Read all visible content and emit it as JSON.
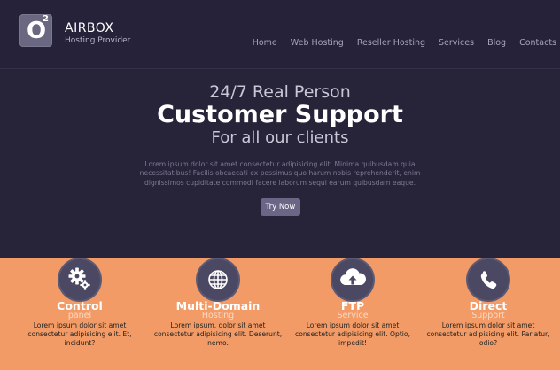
{
  "brand": {
    "logo_letter": "O",
    "logo_sup": "2",
    "name": "AIRBOX",
    "tagline": "Hosting Provider"
  },
  "nav": {
    "items": [
      "Home",
      "Web Hosting",
      "Reseller Hosting",
      "Services",
      "Blog",
      "Contacts"
    ]
  },
  "hero": {
    "line1": "24/7 Real Person",
    "line2": "Customer Support",
    "line3": "For all our clients",
    "paragraph": "Lorem ipsum dolor sit amet consectetur adipisicing elit. Minima quibusdam quia necessitatibus! Facilis obcaecati ex possimus quo harum nobis reprehenderit, enim dignissimos cupiditate commodi facere laborum sequi earum quibusdam eaque.",
    "cta_label": "Try Now"
  },
  "features": [
    {
      "icon": "gears-icon",
      "title": "Control",
      "subtitle": "panel",
      "desc": "Lorem ipsum dolor sit amet consectetur adipisicing elit. Et, incidunt?"
    },
    {
      "icon": "globe-icon",
      "title": "Multi-Domain",
      "subtitle": "Hosting",
      "desc": "Lorem ipsum, dolor sit amet consectetur adipisicing elit. Deserunt, nemo."
    },
    {
      "icon": "cloud-upload-icon",
      "title": "FTP",
      "subtitle": "Service",
      "desc": "Lorem ipsum dolor sit amet consectetur adipisicing elit. Optio, impedit!"
    },
    {
      "icon": "phone-icon",
      "title": "Direct",
      "subtitle": "Support",
      "desc": "Lorem ipsum dolor sit amet consectetur adipisicing elit. Pariatur, odio?"
    }
  ],
  "colors": {
    "header_bg": "#25223a",
    "hero_bg": "#272339",
    "features_bg": "#f29b66",
    "icon_circle": "#4a4862",
    "cta_bg": "#6b6685"
  }
}
